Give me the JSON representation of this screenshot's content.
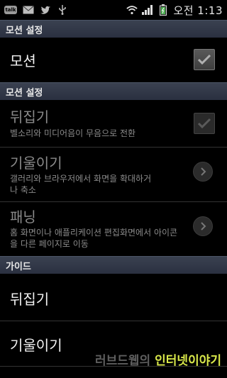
{
  "status_bar": {
    "talk_icon_text": "talk",
    "time_label": "오전 1:13",
    "icons": [
      "talk-icon",
      "mail-icon",
      "twitter-icon",
      "usb-icon",
      "wifi-icon",
      "signal-icon",
      "battery-icon"
    ]
  },
  "sections": {
    "motion_settings_top": "모션 설정",
    "motion_settings": "모션 설정",
    "guide": "가이드"
  },
  "motion_row": {
    "title": "모션",
    "checked": true
  },
  "flip_row": {
    "title": "뒤집기",
    "subtitle": "벨소리와 미디어음이 무음으로 전환",
    "checked": true
  },
  "tilt_row": {
    "title": "기울이기",
    "subtitle": "갤러리와 브라우저에서 화면을 확대하거나 축소"
  },
  "pan_row": {
    "title": "패닝",
    "subtitle": "홈 화면이나 애플리케이션 편집화면에서 아이콘을 다른 페이지로 이동"
  },
  "guide_items": [
    "뒤집기",
    "기울이기"
  ],
  "watermark": {
    "part1": "러브드웹의",
    "part2": "인터넷이야기"
  },
  "colors": {
    "section_bg": "#2f3646",
    "dim_text": "#8a8a8a",
    "watermark_accent": "#d9e84a"
  }
}
